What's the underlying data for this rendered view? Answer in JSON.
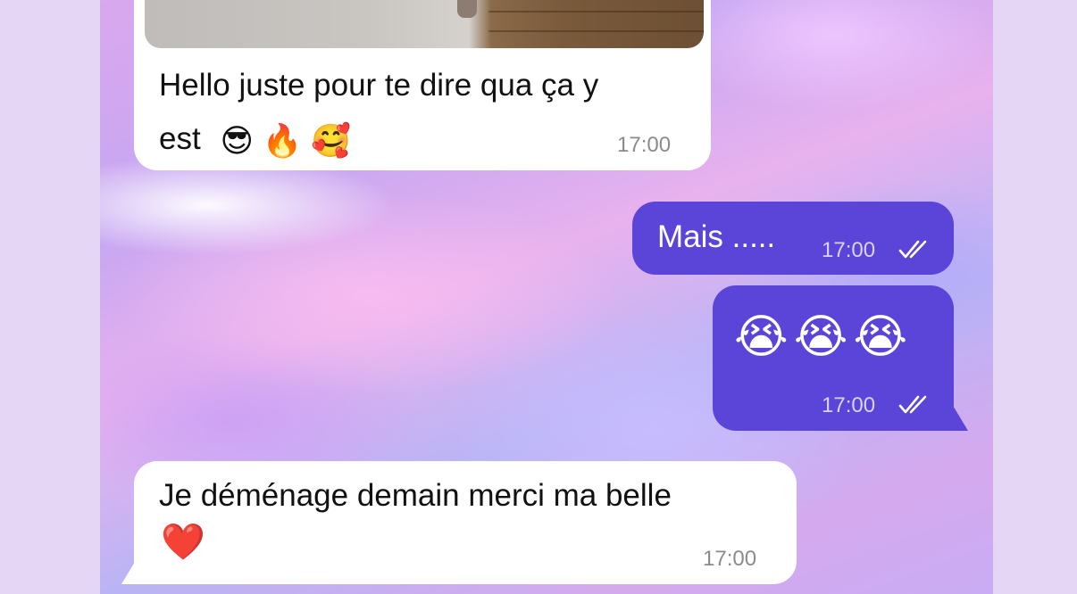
{
  "theme": {
    "incoming_bubble": "#ffffff",
    "outgoing_bubble": "#5b45d8",
    "timestamp_incoming": "#8b8b8b",
    "timestamp_outgoing": "#d9d3ff"
  },
  "messages": [
    {
      "direction": "incoming",
      "has_photo": true,
      "line1": "Hello juste pour te dire qua ça y",
      "line2": "est",
      "emojis": [
        "😎",
        "🔥",
        "🥰"
      ],
      "time": "17:00"
    },
    {
      "direction": "outgoing",
      "text": "Mais .....",
      "time": "17:00",
      "status_icon": "double-check-icon"
    },
    {
      "direction": "outgoing",
      "emojis": [
        "😭",
        "😭",
        "😭"
      ],
      "time": "17:00",
      "status_icon": "double-check-icon"
    },
    {
      "direction": "incoming",
      "line1": "Je déménage demain merci ma belle",
      "emojis": [
        "❤️"
      ],
      "time": "17:00"
    }
  ]
}
